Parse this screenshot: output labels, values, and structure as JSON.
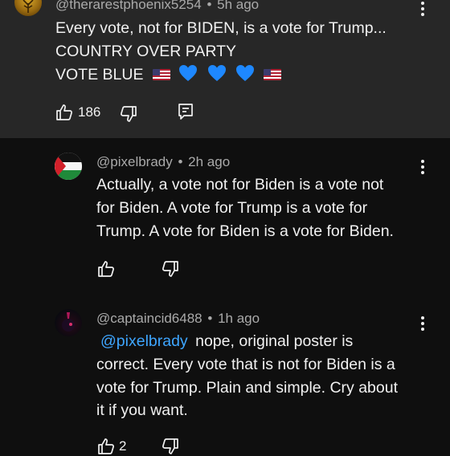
{
  "comments": [
    {
      "username": "@therarestphoenix5254",
      "time": "5h ago",
      "lines": [
        "Every vote, not for BIDEN, is a vote for Trump...",
        "COUNTRY OVER PARTY",
        "VOTE BLUE"
      ],
      "likes": "186"
    },
    {
      "username": "@pixelbrady",
      "time": "2h ago",
      "lines": [
        "Actually, a vote not for Biden is a vote not",
        "for Biden. A vote for Trump is a vote for",
        "Trump. A vote for Biden is a vote for Biden."
      ]
    },
    {
      "username": "@captaincid6488",
      "time": "1h ago",
      "mention": "@pixelbrady",
      "lines": [
        "nope, original poster is",
        "correct. Every vote that is not for Biden is a",
        "vote for Trump. Plain and simple. Cry about",
        "it if you want."
      ],
      "likes": "2"
    }
  ],
  "separator": "•",
  "icons": {
    "like": "thumbs-up-icon",
    "dislike": "thumbs-down-icon",
    "reply": "reply-icon",
    "more": "more-options-icon",
    "flag": "us-flag-emoji",
    "heart": "blue-heart-emoji"
  },
  "colors": {
    "background": "#0f0f0f",
    "highlight_background": "#272727",
    "mention": "#3ea6ff",
    "heart": "#1e88ff"
  }
}
